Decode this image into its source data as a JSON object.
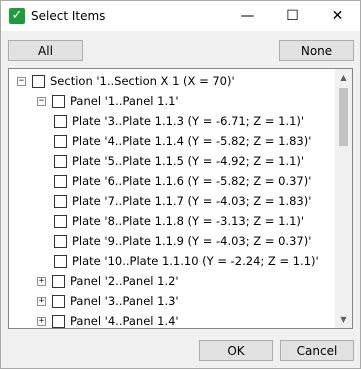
{
  "window": {
    "title": "Select Items",
    "controls": {
      "minimize": "—",
      "maximize": "☐",
      "close": "✕"
    }
  },
  "toolbar": {
    "all_label": "All",
    "none_label": "None"
  },
  "tree": {
    "expand_glyph": "+",
    "collapse_glyph": "−",
    "items": [
      {
        "label": "Section '1..Section X 1 (X = 70)'",
        "level": 0,
        "expanded": true
      },
      {
        "label": "Panel '1..Panel 1.1'",
        "level": 1,
        "expanded": true
      },
      {
        "label": "Plate '3..Plate 1.1.3 (Y = -6.71; Z = 1.1)'",
        "level": 2
      },
      {
        "label": "Plate '4..Plate 1.1.4 (Y = -5.82; Z = 1.83)'",
        "level": 2
      },
      {
        "label": "Plate '5..Plate 1.1.5 (Y = -4.92; Z = 1.1)'",
        "level": 2
      },
      {
        "label": "Plate '6..Plate 1.1.6 (Y = -5.82; Z = 0.37)'",
        "level": 2
      },
      {
        "label": "Plate '7..Plate 1.1.7 (Y = -4.03; Z = 1.83)'",
        "level": 2
      },
      {
        "label": "Plate '8..Plate 1.1.8 (Y = -3.13; Z = 1.1)'",
        "level": 2
      },
      {
        "label": "Plate '9..Plate 1.1.9 (Y = -4.03; Z = 0.37)'",
        "level": 2
      },
      {
        "label": "Plate '10..Plate 1.1.10 (Y = -2.24; Z = 1.1)'",
        "level": 2
      },
      {
        "label": "Panel '2..Panel 1.2'",
        "level": 1,
        "expanded": false
      },
      {
        "label": "Panel '3..Panel 1.3'",
        "level": 1,
        "expanded": false
      },
      {
        "label": "Panel '4..Panel 1.4'",
        "level": 1,
        "expanded": false
      }
    ]
  },
  "scrollbar": {
    "up_arrow": "▲",
    "down_arrow": "▼"
  },
  "footer": {
    "ok_label": "OK",
    "cancel_label": "Cancel"
  }
}
